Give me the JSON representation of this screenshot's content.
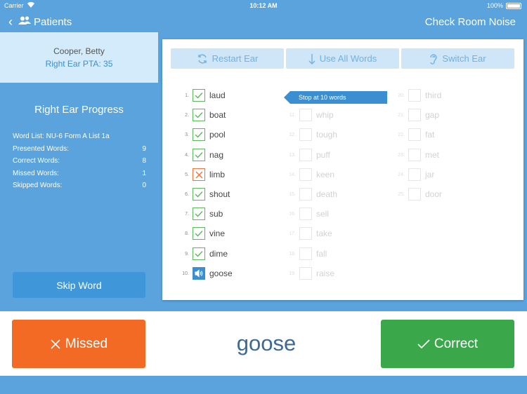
{
  "status": {
    "carrier": "Carrier",
    "time": "10:12 AM",
    "battery": "100%"
  },
  "nav": {
    "back_label": "Patients",
    "right_action": "Check Room Noise"
  },
  "patient": {
    "name": "Cooper, Betty",
    "pta": "Right Ear PTA: 35"
  },
  "progress": {
    "title": "Right Ear Progress",
    "stats": [
      {
        "label": "Word List: NU-6 Form A List 1a",
        "value": ""
      },
      {
        "label": "Presented Words:",
        "value": "9"
      },
      {
        "label": "Correct Words:",
        "value": "8"
      },
      {
        "label": "Missed Words:",
        "value": "1"
      },
      {
        "label": "Skipped Words:",
        "value": "0"
      }
    ],
    "skip_label": "Skip Word"
  },
  "toolbar": {
    "restart": "Restart Ear",
    "use_all": "Use All Words",
    "switch": "Switch Ear"
  },
  "stop_tag": "Stop at 10 words",
  "words": [
    {
      "n": "1.",
      "w": "laud",
      "s": "correct"
    },
    {
      "n": "2.",
      "w": "boat",
      "s": "correct"
    },
    {
      "n": "3.",
      "w": "pool",
      "s": "correct"
    },
    {
      "n": "4.",
      "w": "nag",
      "s": "correct"
    },
    {
      "n": "5.",
      "w": "limb",
      "s": "missed"
    },
    {
      "n": "6.",
      "w": "shout",
      "s": "correct"
    },
    {
      "n": "7.",
      "w": "sub",
      "s": "correct"
    },
    {
      "n": "8.",
      "w": "vine",
      "s": "correct"
    },
    {
      "n": "9.",
      "w": "dime",
      "s": "correct"
    },
    {
      "n": "10.",
      "w": "goose",
      "s": "current"
    },
    {
      "n": "11.",
      "w": "whip",
      "s": "inactive"
    },
    {
      "n": "12.",
      "w": "tough",
      "s": "inactive"
    },
    {
      "n": "13.",
      "w": "puff",
      "s": "inactive"
    },
    {
      "n": "14.",
      "w": "keen",
      "s": "inactive"
    },
    {
      "n": "15.",
      "w": "death",
      "s": "inactive"
    },
    {
      "n": "16.",
      "w": "sell",
      "s": "inactive"
    },
    {
      "n": "17.",
      "w": "take",
      "s": "inactive"
    },
    {
      "n": "18.",
      "w": "fall",
      "s": "inactive"
    },
    {
      "n": "19.",
      "w": "raise",
      "s": "inactive"
    },
    {
      "n": "20.",
      "w": "third",
      "s": "inactive"
    },
    {
      "n": "21.",
      "w": "gap",
      "s": "inactive"
    },
    {
      "n": "22.",
      "w": "fat",
      "s": "inactive"
    },
    {
      "n": "23.",
      "w": "met",
      "s": "inactive"
    },
    {
      "n": "24.",
      "w": "jar",
      "s": "inactive"
    },
    {
      "n": "25.",
      "w": "door",
      "s": "inactive"
    }
  ],
  "response": {
    "missed": "Missed",
    "current_word": "goose",
    "correct": "Correct"
  },
  "colors": {
    "accent": "#5aa3dc",
    "missed": "#f26a23",
    "correct": "#3aa84a",
    "word": "#3c6a95"
  }
}
